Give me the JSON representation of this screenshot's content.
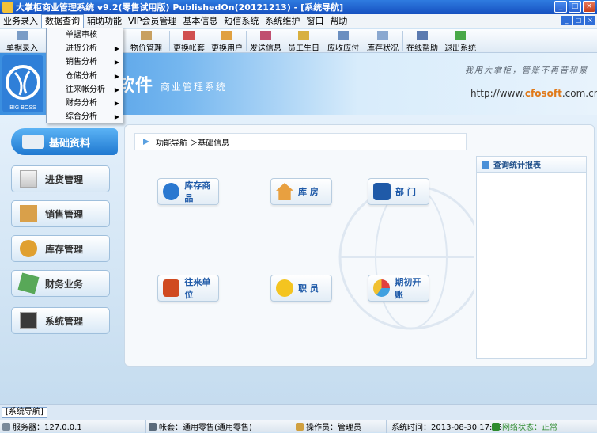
{
  "window": {
    "title": "大掌柜商业管理系统 v9.2(零售试用版) PublishedOn(20121213)  - [系统导航]",
    "min": "_",
    "max": "□",
    "close": "×"
  },
  "menubar": {
    "items": [
      "业务录入",
      "数据查询",
      "辅助功能",
      "VIP会员管理",
      "基本信息",
      "短信系统",
      "系统维护",
      "窗口",
      "帮助"
    ],
    "active_index": 1
  },
  "toolbar": {
    "items": [
      "单据录入",
      "物价管理",
      "更换帐套",
      "更换用户",
      "发送信息",
      "员工生日",
      "应收应付",
      "库存状况",
      "在线帮助",
      "退出系统"
    ]
  },
  "dropdown": {
    "items": [
      {
        "label": "单据审核",
        "submenu": false
      },
      {
        "label": "进货分析",
        "submenu": true
      },
      {
        "label": "销售分析",
        "submenu": true
      },
      {
        "label": "仓储分析",
        "submenu": true
      },
      {
        "label": "往来帐分析",
        "submenu": true
      },
      {
        "label": "财务分析",
        "submenu": true
      },
      {
        "label": "综合分析",
        "submenu": true
      }
    ],
    "arrow": "▶"
  },
  "banner": {
    "brand": "软件",
    "subtitle": "商业管理系统",
    "slogan": "我用大掌柜，管账不再苦和累",
    "url_prefix": "http://www.",
    "url_brand": "cfosoft",
    "url_suffix": ".com.cn",
    "logo_text": "BIG BOSS"
  },
  "sidebar": {
    "header": "基础资料",
    "items": [
      "进货管理",
      "销售管理",
      "库存管理",
      "财务业务",
      "系统管理"
    ]
  },
  "breadcrumb": "功能导航 ＞基础信息",
  "tiles": [
    "库存商品",
    "库 房",
    "部 门",
    "往来单位",
    "职 员",
    "期初开账"
  ],
  "panel": {
    "title": "查询统计报表"
  },
  "mdi_tab": "[系统导航]",
  "status": {
    "server": "服务器：127.0.0.1",
    "account": "帐套：通用零售(通用零售)",
    "operator": "操作员：管理员",
    "time": "系统时间：2013-08-30 17:25",
    "network": "网络状态：正常"
  },
  "colors": {
    "titlebar": "#1f5fd0",
    "accent": "#1f78d0",
    "tile_text": "#1f5aa8",
    "network_ok": "#2e8b2e"
  }
}
